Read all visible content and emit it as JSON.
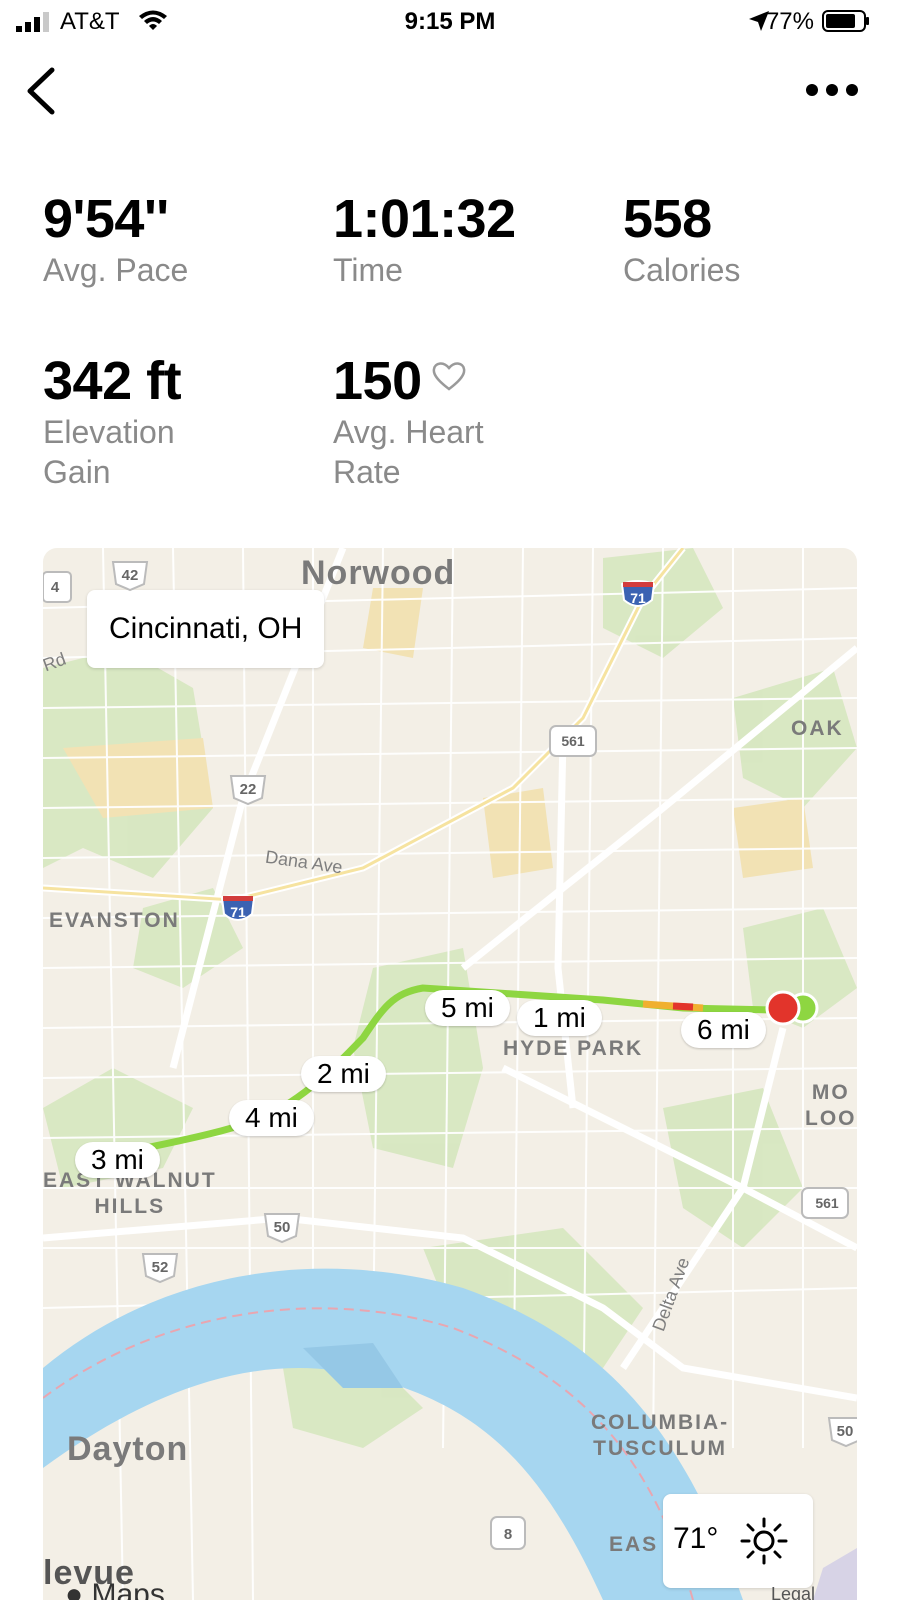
{
  "status_bar": {
    "carrier": "AT&T",
    "time": "9:15 PM",
    "battery_percent": "77%",
    "icons": [
      "signal-icon",
      "wifi-icon",
      "location-arrow-icon",
      "battery-icon"
    ]
  },
  "nav": {
    "back_icon": "chevron-left-icon",
    "more_icon": "ellipsis-icon"
  },
  "stats": {
    "pace": {
      "value": "9'54''",
      "label": "Avg. Pace"
    },
    "time": {
      "value": "1:01:32",
      "label": "Time"
    },
    "calories": {
      "value": "558",
      "label": "Calories"
    },
    "elevation": {
      "value": "342 ft",
      "label_line1": "Elevation",
      "label_line2": "Gain"
    },
    "heart_rate": {
      "value": "150",
      "label_line1": "Avg. Heart",
      "label_line2": "Rate",
      "icon": "heart-outline-icon"
    }
  },
  "map": {
    "city_label": "Cincinnati, OH",
    "places": {
      "norwood": "Norwood",
      "oak": "OAK",
      "evanston": "EVANSTON",
      "hyde_park": "HYDE PARK",
      "east_walnut_1": "EAST WALNUT",
      "east_walnut_2": "HILLS",
      "mo": "MO",
      "loo": "LOO",
      "columbia_1": "COLUMBIA-",
      "columbia_2": "TUSCULUM",
      "dayton": "Dayton",
      "east": "EAS",
      "bellevue": "levue"
    },
    "streets": {
      "dana": "Dana Ave",
      "delta": "Delta Ave",
      "rd": "Rd"
    },
    "shields": {
      "s42": "42",
      "s4": "4",
      "s71a": "71",
      "s561a": "561",
      "s22": "22",
      "s71b": "71",
      "s50": "50",
      "s52": "52",
      "s561b": "561",
      "s8": "8",
      "s50b": "50"
    },
    "mile_markers": {
      "m5": "5 mi",
      "m1": "1 mi",
      "m6": "6 mi",
      "m2": "2 mi",
      "m4": "4 mi",
      "m3": "3 mi"
    },
    "route_colors": {
      "main": "#8ed641",
      "slow": "#e2342b",
      "mid": "#f0b030"
    },
    "weather": {
      "temp": "71°",
      "icon": "sun-icon"
    },
    "attribution": {
      "logo": "Maps",
      "legal": "Legal"
    }
  }
}
